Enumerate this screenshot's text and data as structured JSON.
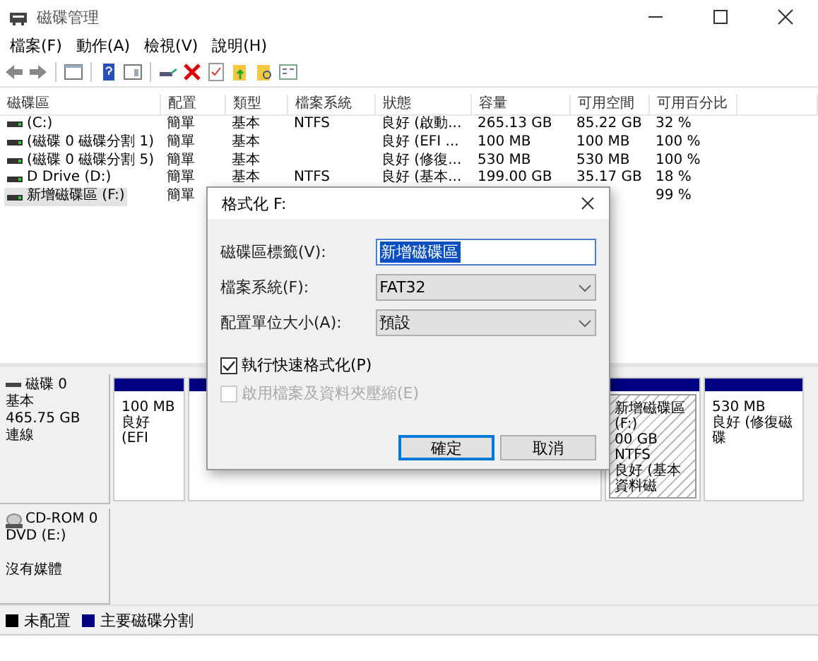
{
  "window": {
    "title": "磁碟管理"
  },
  "menu": [
    "檔案(F)",
    "動作(A)",
    "檢視(V)",
    "說明(H)"
  ],
  "volumes": {
    "columns": [
      "磁碟區",
      "配置",
      "類型",
      "檔案系統",
      "狀態",
      "容量",
      "可用空間",
      "可用百分比"
    ],
    "rows": [
      {
        "cells": [
          "(C:)",
          "簡單",
          "基本",
          "NTFS",
          "良好 (啟動...",
          "265.13 GB",
          "85.22 GB",
          "32 %"
        ],
        "selected": false
      },
      {
        "cells": [
          "(磁碟 0 磁碟分割 1)",
          "簡單",
          "基本",
          "",
          "良好 (EFI ...",
          "100 MB",
          "100 MB",
          "100 %"
        ],
        "selected": false
      },
      {
        "cells": [
          "(磁碟 0 磁碟分割 5)",
          "簡單",
          "基本",
          "",
          "良好 (修復...",
          "530 MB",
          "530 MB",
          "100 %"
        ],
        "selected": false
      },
      {
        "cells": [
          "D Drive (D:)",
          "簡單",
          "基本",
          "NTFS",
          "良好 (基本...",
          "199.00 GB",
          "35.17 GB",
          "18 %"
        ],
        "selected": false
      },
      {
        "cells": [
          "新增磁碟區 (F:)",
          "簡單",
          "",
          "",
          "",
          "",
          "",
          "99 %"
        ],
        "selected": true
      }
    ]
  },
  "disks": [
    {
      "kind": "disk",
      "name": "磁碟 0",
      "type": "基本",
      "size": "465.75 GB",
      "status": "連線",
      "partitions": [
        {
          "lines": [
            "100 MB",
            "良好 (EFI"
          ],
          "selected": false
        },
        {
          "selected": false
        },
        {
          "lines": [
            "新增磁碟區 (F:)",
            "00 GB NTFS",
            "良好 (基本資料磁"
          ],
          "selected": true
        },
        {
          "lines": [
            "530 MB",
            "良好 (修復磁碟"
          ],
          "selected": false
        }
      ]
    },
    {
      "kind": "cdrom",
      "name": "CD-ROM 0",
      "type": "DVD (E:)",
      "status": "沒有媒體"
    }
  ],
  "legend": [
    {
      "label": "未配置",
      "color": "#000000"
    },
    {
      "label": "主要磁碟分割",
      "color": "#000080"
    }
  ],
  "dialog": {
    "title": "格式化 F:",
    "fields": [
      {
        "label": "磁碟區標籤(V):",
        "kind": "text",
        "value": "新增磁碟區"
      },
      {
        "label": "檔案系統(F):",
        "kind": "select",
        "value": "FAT32"
      },
      {
        "label": "配置單位大小(A):",
        "kind": "select",
        "value": "預設"
      }
    ],
    "options": [
      {
        "label": "執行快速格式化(P)",
        "checked": true,
        "disabled": false
      },
      {
        "label": "啟用檔案及資料夾壓縮(E)",
        "checked": false,
        "disabled": true
      }
    ],
    "buttons": [
      {
        "label": "確定",
        "default": true
      },
      {
        "label": "取消",
        "default": false
      }
    ]
  }
}
